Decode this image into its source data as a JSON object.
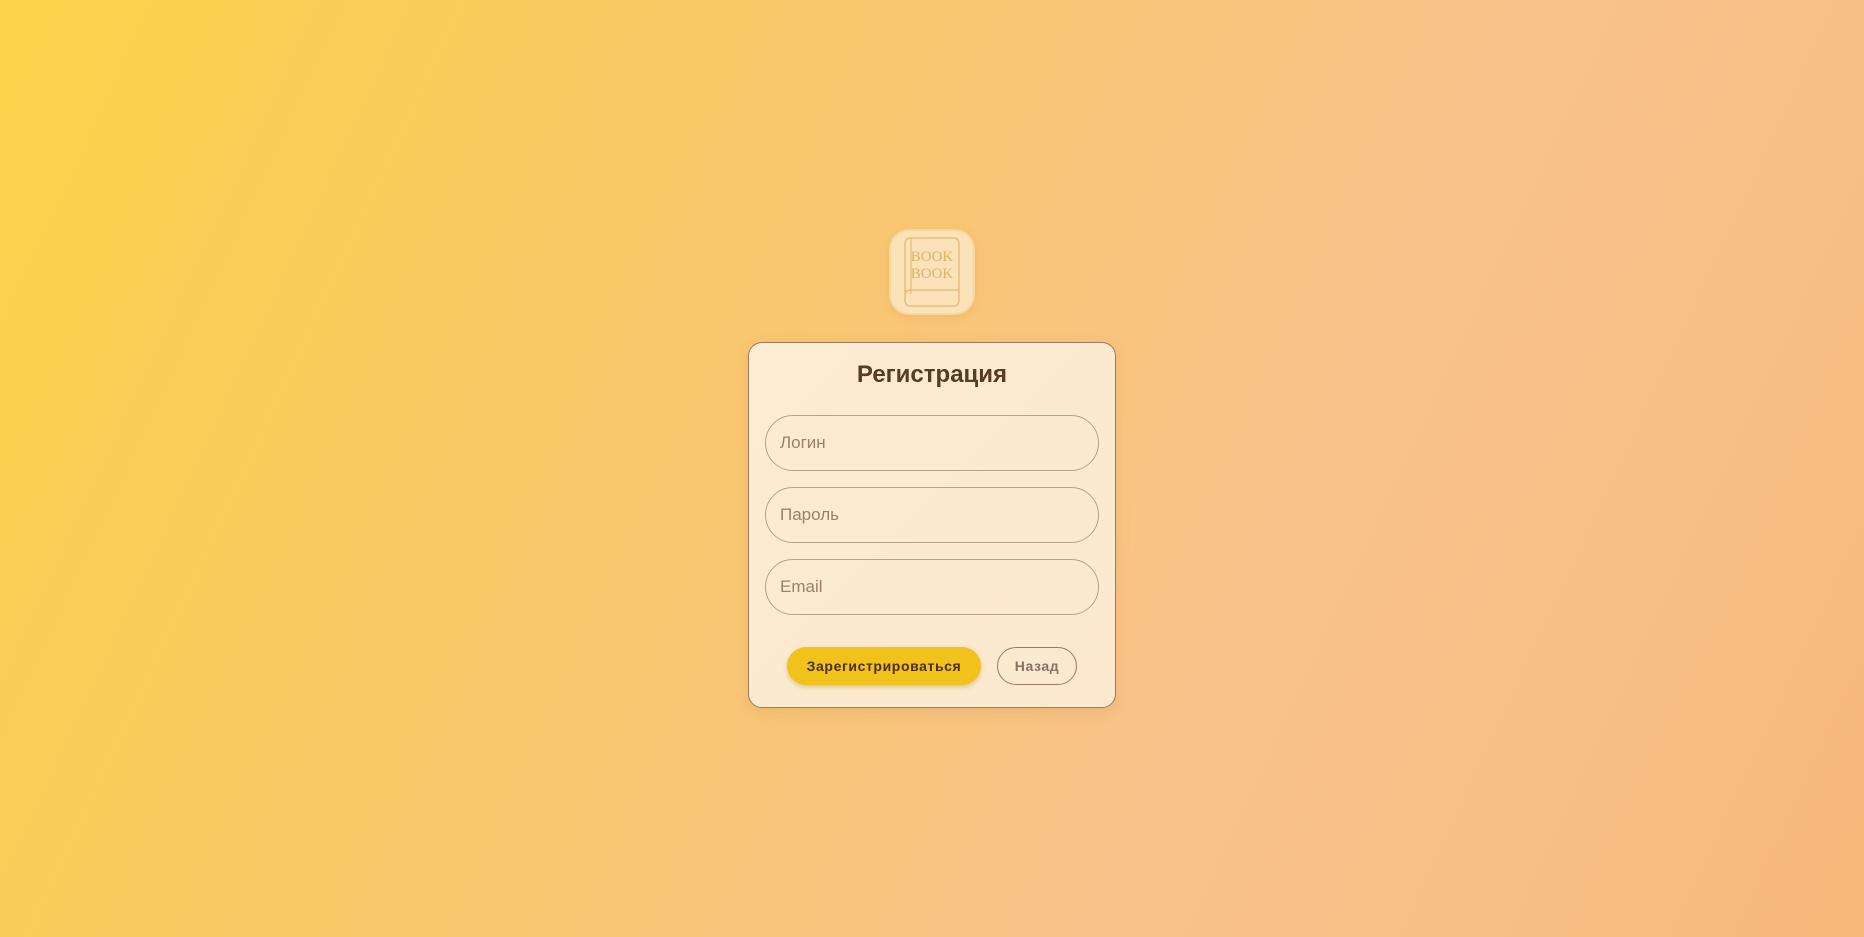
{
  "logo": {
    "line1": "BOOK",
    "line2": "BOOK",
    "icon": "book-icon"
  },
  "form": {
    "title": "Регистрация",
    "login_placeholder": "Логин",
    "password_placeholder": "Пароль",
    "email_placeholder": "Email",
    "register_label": "Зарегистрироваться",
    "back_label": "Назад"
  },
  "colors": {
    "accent": "#f2c21c",
    "title_text": "#5a3a22",
    "card_bg": "#fcecd2"
  }
}
